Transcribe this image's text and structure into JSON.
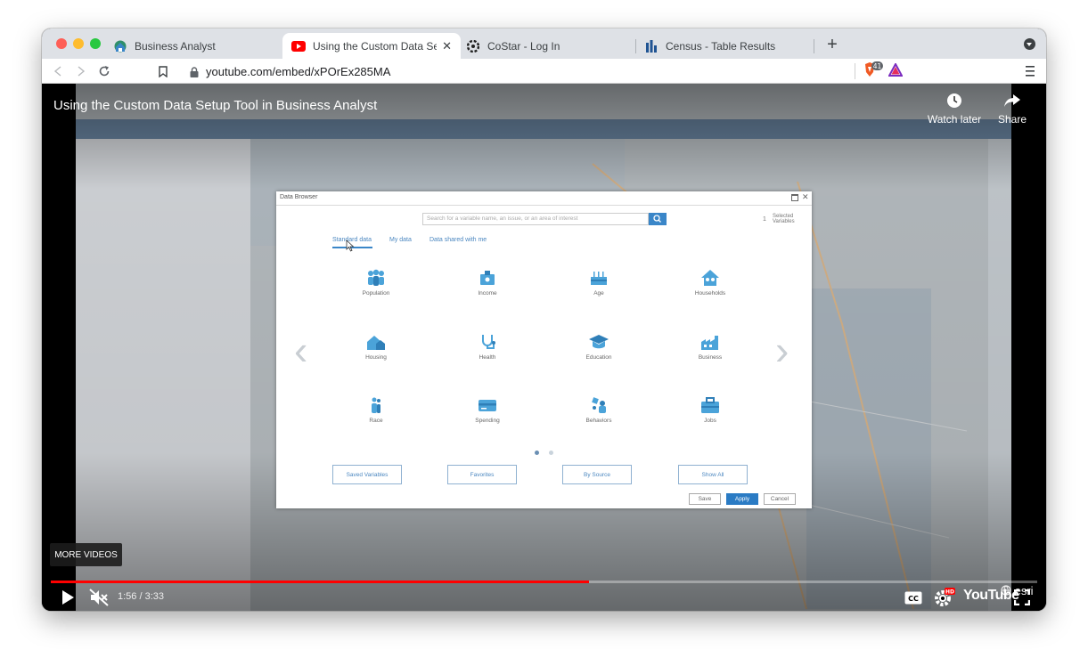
{
  "browser": {
    "tabs": [
      {
        "title": "Business Analyst",
        "icon": "business-analyst-globe-icon",
        "active": false
      },
      {
        "title": "Using the Custom Data Setup T",
        "icon": "youtube-icon",
        "active": true
      },
      {
        "title": "CoStar - Log In",
        "icon": "costar-icon",
        "active": false
      },
      {
        "title": "Census - Table Results",
        "icon": "census-bars-icon",
        "active": false
      }
    ],
    "new_tab": "+",
    "close_tab": "✕",
    "url": "youtube.com/embed/xPOrEx285MA",
    "brave_badge": "41"
  },
  "video": {
    "title": "Using the Custom Data Setup Tool in Business Analyst",
    "watch_later": "Watch later",
    "share": "Share",
    "more_videos": "MORE VIDEOS",
    "time": "1:56 / 3:33",
    "progress_fraction": 0.546,
    "brand": "esri",
    "youtube_label": "YouTube",
    "hd_badge": "HD",
    "cc_label": "CC"
  },
  "dialog": {
    "title": "Data Browser",
    "search_placeholder": "Search for a variable name, an issue, or an area of interest",
    "selected_count": "1",
    "selected_label_1": "Selected",
    "selected_label_2": "Variables",
    "tabs": [
      "Standard data",
      "My data",
      "Data shared with me"
    ],
    "categories": [
      {
        "label": "Population",
        "icon": "population-icon"
      },
      {
        "label": "Income",
        "icon": "income-icon"
      },
      {
        "label": "Age",
        "icon": "age-icon"
      },
      {
        "label": "Households",
        "icon": "households-icon"
      },
      {
        "label": "Housing",
        "icon": "housing-icon"
      },
      {
        "label": "Health",
        "icon": "health-icon"
      },
      {
        "label": "Education",
        "icon": "education-icon"
      },
      {
        "label": "Business",
        "icon": "business-icon"
      },
      {
        "label": "Race",
        "icon": "race-icon"
      },
      {
        "label": "Spending",
        "icon": "spending-icon"
      },
      {
        "label": "Behaviors",
        "icon": "behaviors-icon"
      },
      {
        "label": "Jobs",
        "icon": "jobs-icon"
      }
    ],
    "bottom_buttons": [
      "Saved Variables",
      "Favorites",
      "By Source",
      "Show All"
    ],
    "save": "Save",
    "apply": "Apply",
    "cancel": "Cancel"
  },
  "colors": {
    "accent_blue": "#3a86c8",
    "youtube_red": "#ff0000"
  }
}
